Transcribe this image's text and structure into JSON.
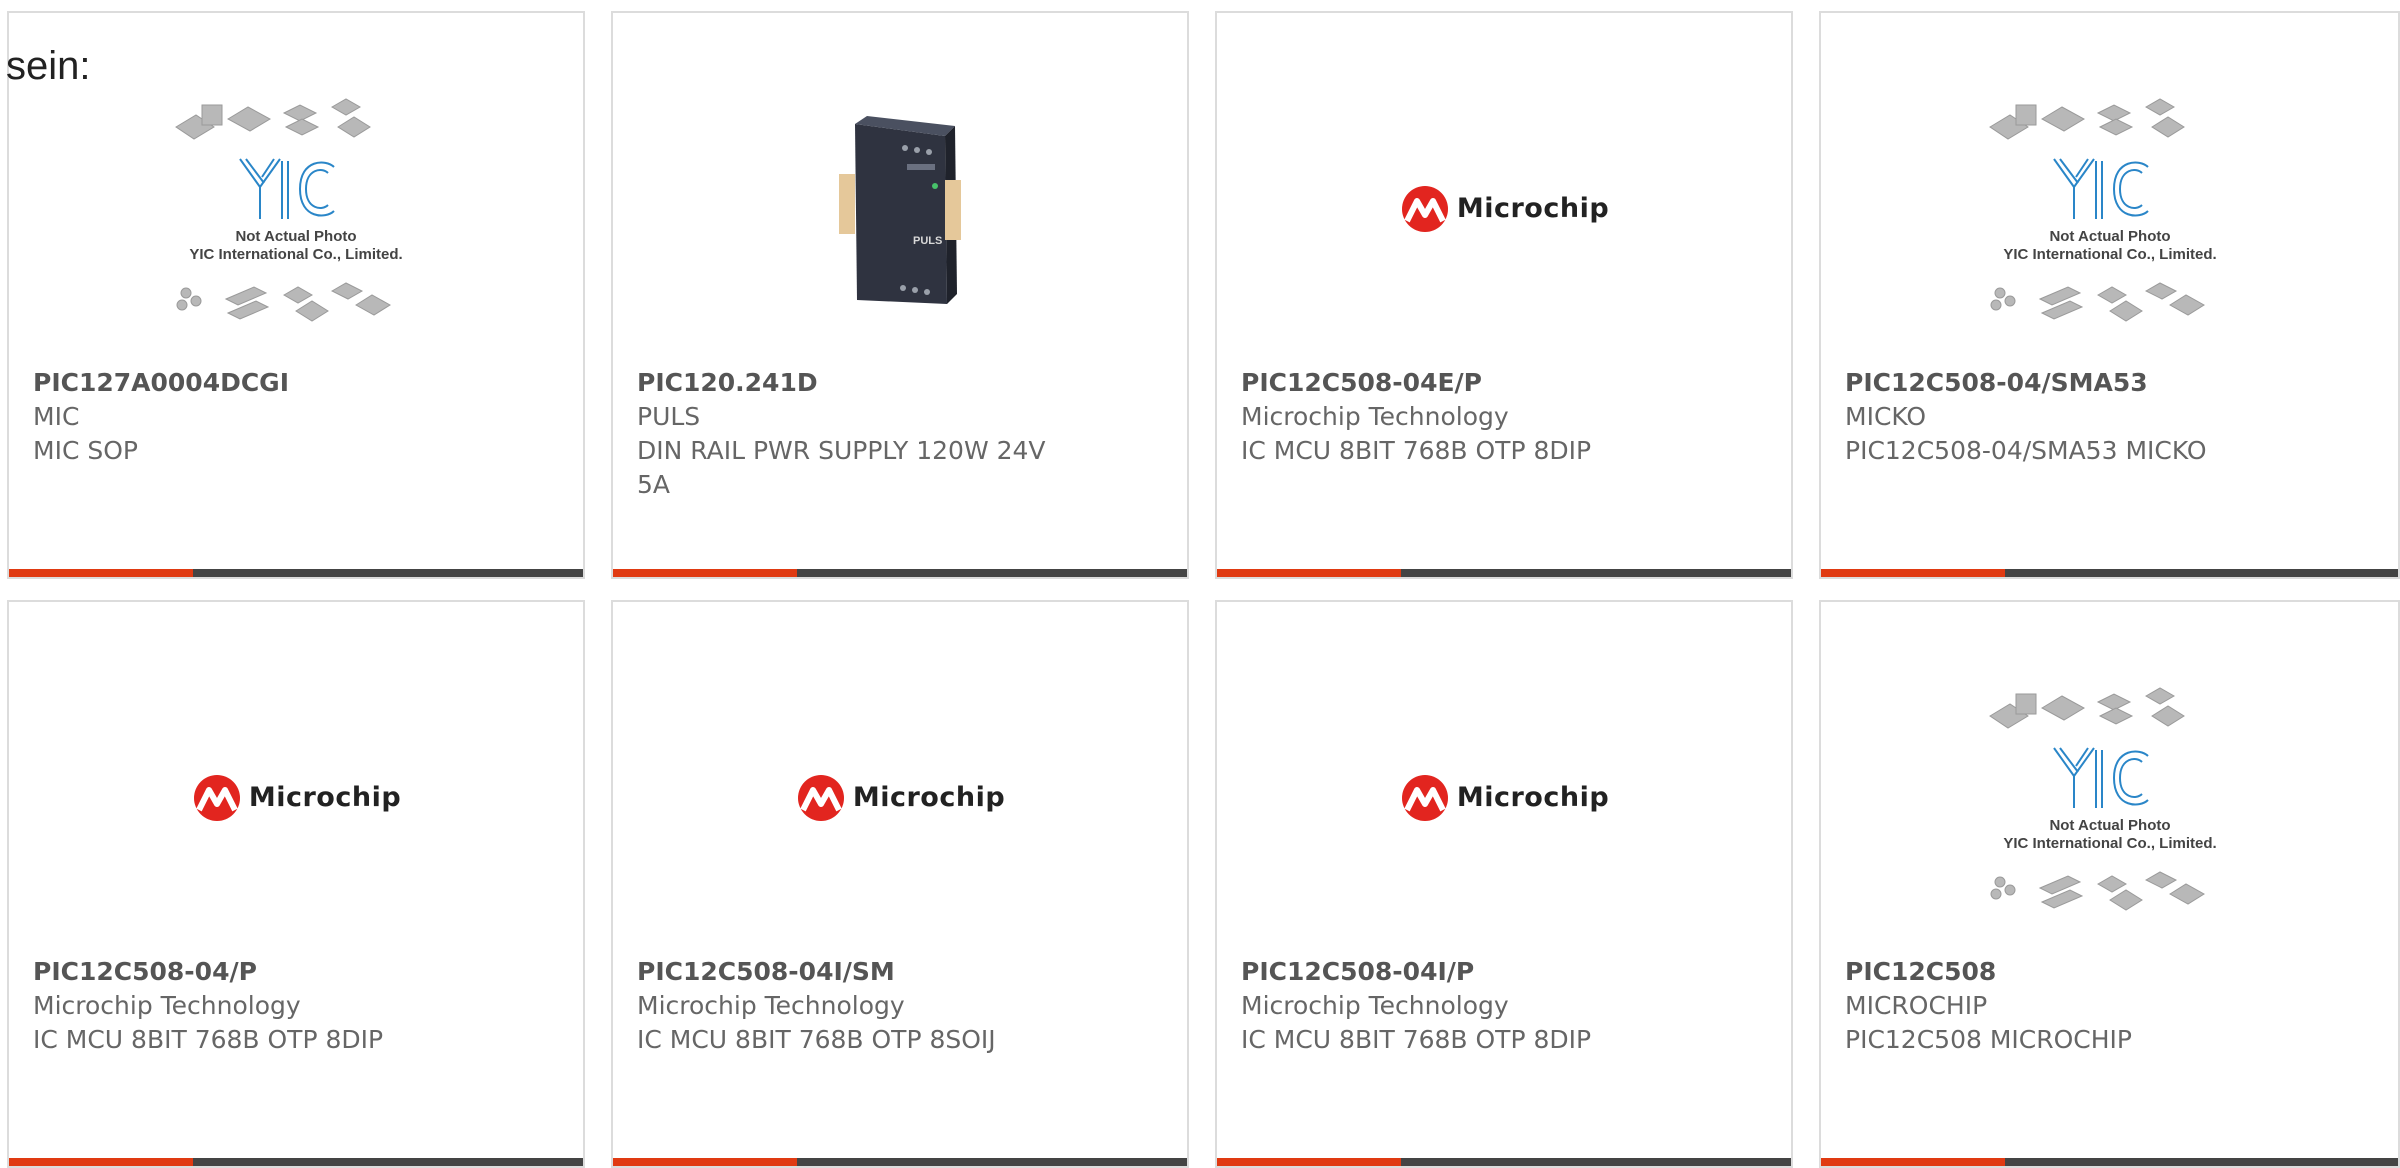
{
  "prefix_text": "sein:",
  "colors": {
    "accent": "#e03a12",
    "bar": "#444444",
    "border": "#dcdcdc",
    "microchip_red": "#e2251f",
    "yic_blue": "#2a86c8"
  },
  "placeholder_image": {
    "caption_line1": "Not Actual Photo",
    "caption_line2": "YIC International Co., Limited.",
    "logo_text": "YIC"
  },
  "microchip_logo": {
    "text": "Microchip"
  },
  "psu_image": {
    "brand": "PULS"
  },
  "products": [
    {
      "part_number": "PIC127A0004DCGI",
      "manufacturer": "MIC",
      "description": "MIC SOP",
      "image": "yic-placeholder"
    },
    {
      "part_number": "PIC120.241D",
      "manufacturer": "PULS",
      "description": "DIN RAIL PWR SUPPLY 120W 24V 5A",
      "image": "psu"
    },
    {
      "part_number": "PIC12C508-04E/P",
      "manufacturer": "Microchip Technology",
      "description": "IC MCU 8BIT 768B OTP 8DIP",
      "image": "microchip-logo"
    },
    {
      "part_number": "PIC12C508-04/SMA53",
      "manufacturer": "MICKO",
      "description": "PIC12C508-04/SMA53 MICKO",
      "image": "yic-placeholder"
    },
    {
      "part_number": "PIC12C508-04/P",
      "manufacturer": "Microchip Technology",
      "description": "IC MCU 8BIT 768B OTP 8DIP",
      "image": "microchip-logo"
    },
    {
      "part_number": "PIC12C508-04I/SM",
      "manufacturer": "Microchip Technology",
      "description": "IC MCU 8BIT 768B OTP 8SOIJ",
      "image": "microchip-logo"
    },
    {
      "part_number": "PIC12C508-04I/P",
      "manufacturer": "Microchip Technology",
      "description": "IC MCU 8BIT 768B OTP 8DIP",
      "image": "microchip-logo"
    },
    {
      "part_number": "PIC12C508",
      "manufacturer": "MICROCHIP",
      "description": "PIC12C508 MICROCHIP",
      "image": "yic-placeholder"
    }
  ]
}
